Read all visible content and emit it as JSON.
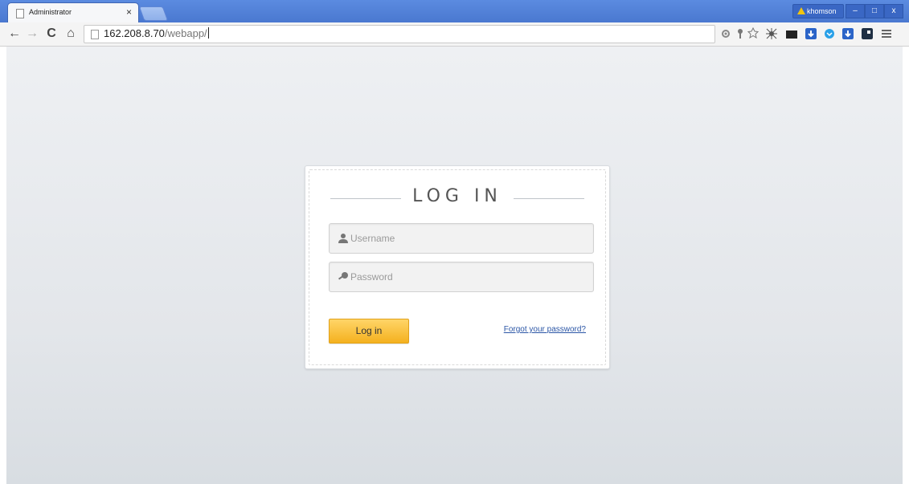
{
  "browser": {
    "tab": {
      "title": "Administrator",
      "close_label": "×"
    },
    "profile": {
      "name": "khomson"
    },
    "window_buttons": {
      "minimize": "–",
      "restore": "□",
      "close": "x"
    },
    "address": {
      "host": "162.208.8.70",
      "path": "/webapp/"
    },
    "nav": {
      "back": "←",
      "forward": "→",
      "reload": "C",
      "home": "⌂"
    },
    "extensions": [
      "ext-settings-icon",
      "ext-key-icon",
      "bookmark-star-icon",
      "ext-bug-icon",
      "ext-screen-icon",
      "ext-download-icon",
      "ext-blue-circle-icon",
      "ext-download2-icon",
      "ext-dark-icon",
      "menu-icon"
    ]
  },
  "login": {
    "title": "LOG IN",
    "username_placeholder": "Username",
    "password_placeholder": "Password",
    "submit_label": "Log in",
    "forgot_label": "Forgot your password?"
  },
  "colors": {
    "chrome_blue": "#4a78d0",
    "login_button": "#f4b11f",
    "link": "#2b56a6"
  }
}
